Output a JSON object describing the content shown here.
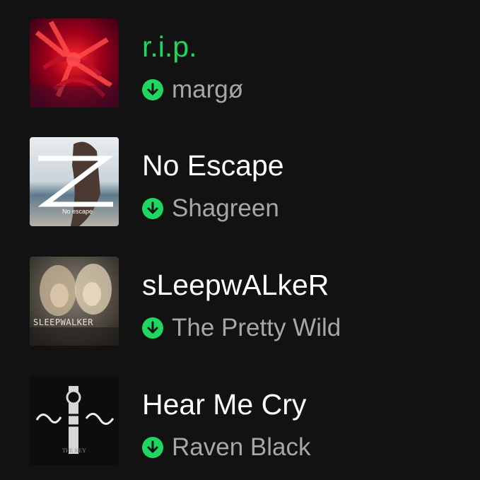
{
  "colors": {
    "background": "#121212",
    "playing_title": "#1ed760",
    "title": "#ffffff",
    "artist": "#a7a7a7",
    "download_badge": "#1ed760"
  },
  "tracks": [
    {
      "title": "r.i.p.",
      "artist": "margø",
      "playing": true,
      "downloaded": true,
      "download_icon": "download-arrow-icon",
      "art_text": ""
    },
    {
      "title": "No Escape",
      "artist": "Shagreen",
      "playing": false,
      "downloaded": true,
      "download_icon": "download-arrow-icon",
      "art_text": "No escape"
    },
    {
      "title": "sLeepwALkeR",
      "artist": "The Pretty Wild",
      "playing": false,
      "downloaded": true,
      "download_icon": "download-arrow-icon",
      "art_text": "SLEEPWALKER"
    },
    {
      "title": "Hear Me Cry",
      "artist": "Raven Black",
      "playing": false,
      "downloaded": true,
      "download_icon": "download-arrow-icon",
      "art_text": "THE KEY"
    }
  ]
}
